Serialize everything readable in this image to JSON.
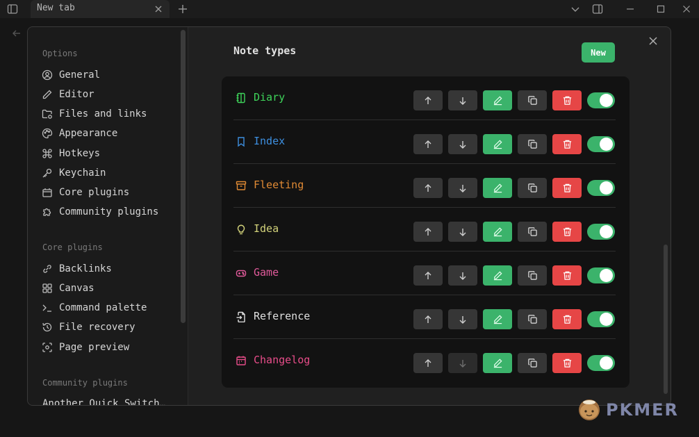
{
  "window": {
    "tab_title": "New tab"
  },
  "settings": {
    "sections": [
      {
        "title": "Options",
        "items": [
          {
            "label": "General",
            "icon": "user-circle-icon"
          },
          {
            "label": "Editor",
            "icon": "pencil-icon"
          },
          {
            "label": "Files and links",
            "icon": "folder-link-icon"
          },
          {
            "label": "Appearance",
            "icon": "palette-icon"
          },
          {
            "label": "Hotkeys",
            "icon": "command-icon"
          },
          {
            "label": "Keychain",
            "icon": "key-icon"
          },
          {
            "label": "Core plugins",
            "icon": "plugin-box-icon"
          },
          {
            "label": "Community plugins",
            "icon": "puzzle-icon"
          }
        ]
      },
      {
        "title": "Core plugins",
        "items": [
          {
            "label": "Backlinks",
            "icon": "link-icon"
          },
          {
            "label": "Canvas",
            "icon": "layout-grid-icon"
          },
          {
            "label": "Command palette",
            "icon": "terminal-icon"
          },
          {
            "label": "File recovery",
            "icon": "history-icon"
          },
          {
            "label": "Page preview",
            "icon": "preview-icon"
          }
        ]
      },
      {
        "title": "Community plugins",
        "items": [
          {
            "label": "Another Quick Switch…"
          }
        ]
      }
    ]
  },
  "content": {
    "heading": "Note types",
    "new_button": "New",
    "note_types": [
      {
        "name": "Diary",
        "color": "#3ed45a",
        "icon": "notebook-icon",
        "down_enabled": true,
        "enabled": true
      },
      {
        "name": "Index",
        "color": "#3d8fe0",
        "icon": "bookmark-icon",
        "down_enabled": true,
        "enabled": true
      },
      {
        "name": "Fleeting",
        "color": "#e08a34",
        "icon": "archive-icon",
        "down_enabled": true,
        "enabled": true
      },
      {
        "name": "Idea",
        "color": "#d2d27a",
        "icon": "lightbulb-icon",
        "down_enabled": true,
        "enabled": true
      },
      {
        "name": "Game",
        "color": "#e05a9a",
        "icon": "gamepad-icon",
        "down_enabled": true,
        "enabled": true
      },
      {
        "name": "Reference",
        "color": "#e0e0e0",
        "icon": "file-import-icon",
        "down_enabled": true,
        "enabled": true
      },
      {
        "name": "Changelog",
        "color": "#e84d8a",
        "icon": "calendar-icon",
        "down_enabled": false,
        "enabled": true
      }
    ]
  },
  "watermark": {
    "text": "PKMER"
  }
}
